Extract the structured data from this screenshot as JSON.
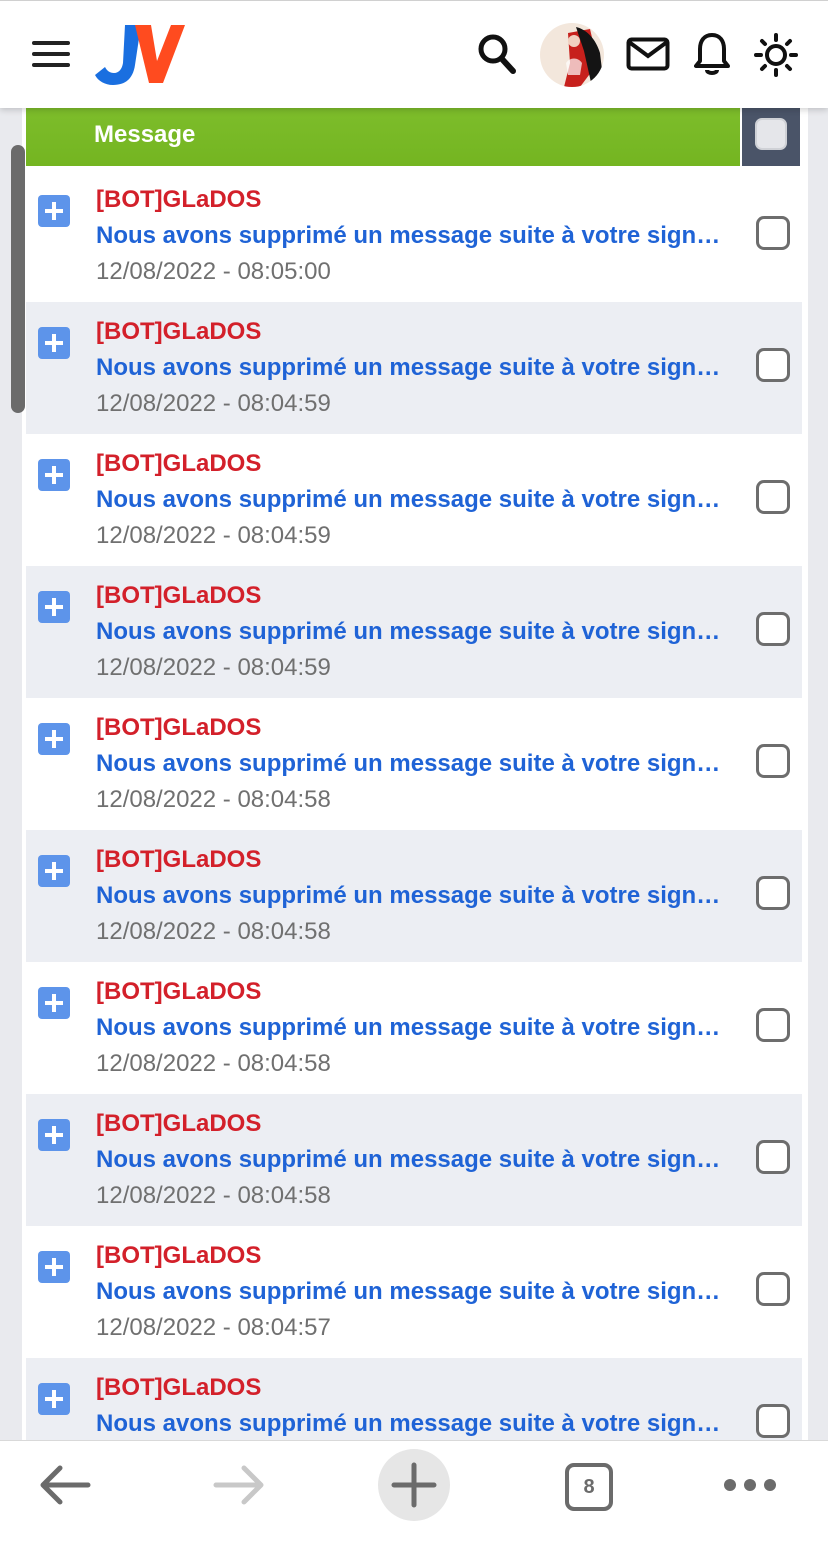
{
  "header": {
    "logo_text": "JV",
    "icons": [
      "menu-icon",
      "search-icon",
      "avatar",
      "mail-icon",
      "bell-icon",
      "sun-icon"
    ]
  },
  "table": {
    "column_message": "Message"
  },
  "messages": [
    {
      "author": "[BOT]GLaDOS",
      "subject": "Nous avons supprimé un message suite à votre signalement",
      "date": "12/08/2022 - 08:05:00"
    },
    {
      "author": "[BOT]GLaDOS",
      "subject": "Nous avons supprimé un message suite à votre signalement",
      "date": "12/08/2022 - 08:04:59"
    },
    {
      "author": "[BOT]GLaDOS",
      "subject": "Nous avons supprimé un message suite à votre signalement",
      "date": "12/08/2022 - 08:04:59"
    },
    {
      "author": "[BOT]GLaDOS",
      "subject": "Nous avons supprimé un message suite à votre signalement",
      "date": "12/08/2022 - 08:04:59"
    },
    {
      "author": "[BOT]GLaDOS",
      "subject": "Nous avons supprimé un message suite à votre signalement",
      "date": "12/08/2022 - 08:04:58"
    },
    {
      "author": "[BOT]GLaDOS",
      "subject": "Nous avons supprimé un message suite à votre signalement",
      "date": "12/08/2022 - 08:04:58"
    },
    {
      "author": "[BOT]GLaDOS",
      "subject": "Nous avons supprimé un message suite à votre signalement",
      "date": "12/08/2022 - 08:04:58"
    },
    {
      "author": "[BOT]GLaDOS",
      "subject": "Nous avons supprimé un message suite à votre signalement",
      "date": "12/08/2022 - 08:04:58"
    },
    {
      "author": "[BOT]GLaDOS",
      "subject": "Nous avons supprimé un message suite à votre signalement",
      "date": "12/08/2022 - 08:04:57"
    },
    {
      "author": "[BOT]GLaDOS",
      "subject": "Nous avons supprimé un message suite à votre signalement",
      "date": ""
    }
  ],
  "browser": {
    "tab_count": "8"
  },
  "colors": {
    "header_green": "#74b521",
    "author_red": "#d3202a",
    "subject_blue": "#1f63d6",
    "plus_blue": "#5d94ea",
    "row_alt": "#eceef3"
  }
}
